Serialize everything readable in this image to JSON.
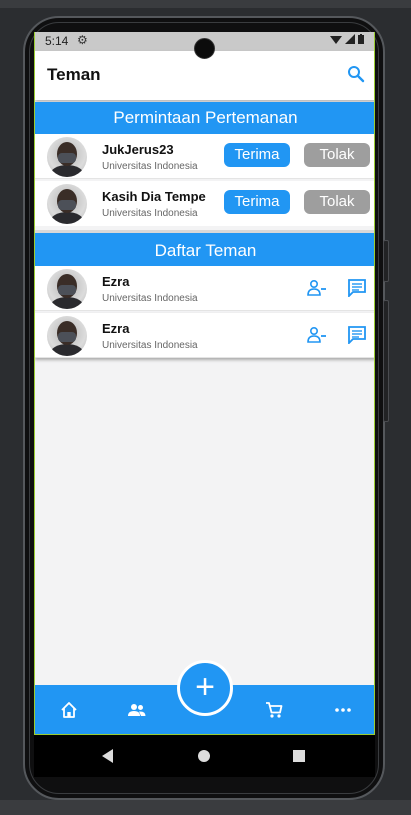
{
  "status_bar": {
    "time": "5:14"
  },
  "app_bar": {
    "title": "Teman"
  },
  "requests": {
    "header": "Permintaan Pertemanan",
    "accept_label": "Terima",
    "reject_label": "Tolak",
    "items": [
      {
        "name": "JukJerus23",
        "university": "Universitas Indonesia"
      },
      {
        "name": "Kasih Dia Tempe",
        "university": "Universitas Indonesia"
      }
    ]
  },
  "friends": {
    "header": "Daftar Teman",
    "items": [
      {
        "name": "Ezra",
        "university": "Universitas Indonesia"
      },
      {
        "name": "Ezra",
        "university": "Universitas Indonesia"
      }
    ]
  },
  "bottom_nav": {
    "items": [
      "home-icon",
      "people-icon",
      "add-icon",
      "cart-icon",
      "more-icon"
    ],
    "fab_symbol": "+"
  },
  "colors": {
    "primary": "#2196f3",
    "reject": "#9e9e9e",
    "background": "#f3f3f4"
  }
}
